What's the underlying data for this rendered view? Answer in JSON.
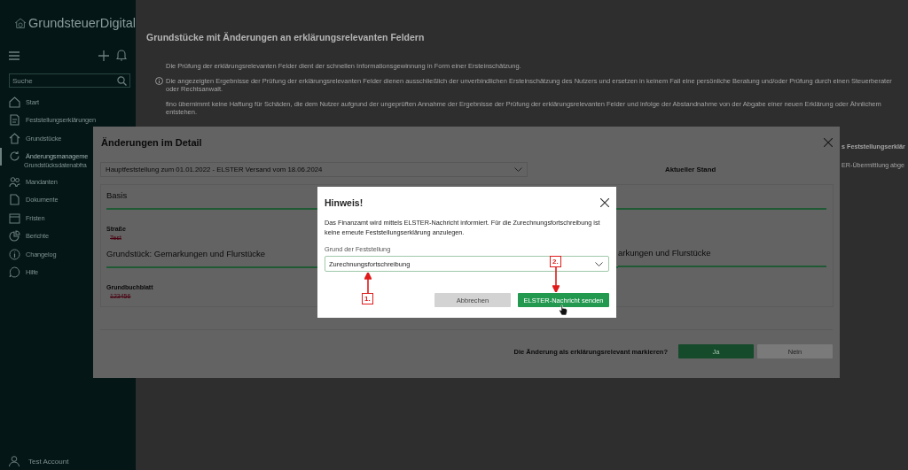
{
  "sidebar": {
    "logo": "GrundsteuerDigital",
    "search": {
      "placeholder": "Suche"
    },
    "items": [
      {
        "label": "Start",
        "selected": false
      },
      {
        "label": "Feststellungserklärungen",
        "selected": false
      },
      {
        "label": "Grundstücke",
        "selected": false
      },
      {
        "label": "Änderungsmanageme",
        "selected": true,
        "children": [
          {
            "label": "Grundstücksdatenabfra"
          }
        ]
      },
      {
        "label": "Mandanten",
        "selected": false
      },
      {
        "label": "Dokumente",
        "selected": false
      },
      {
        "label": "Fristen",
        "selected": false
      },
      {
        "label": "Berichte",
        "selected": false
      },
      {
        "label": "Changelog",
        "selected": false
      },
      {
        "label": "Hilfe",
        "selected": false
      }
    ],
    "account": "Test Account"
  },
  "page": {
    "title": "Grundstücke mit Änderungen an erklärungsrelevanten Feldern",
    "notes": [
      {
        "text": "Die Prüfung der erklärungsrelevanten Felder dient der schnellen Informationsgewinnung in Form einer Ersteinschätzung.",
        "info": false
      },
      {
        "text": "Die angezeigten Ergebnisse der Prüfung der erklärungsrelevanten Felder dienen ausschließlich der unverbindlichen Ersteinschätzung des Nutzers und ersetzen in keinem Fall eine persönliche Beratung und/oder Prüfung durch einen Steuerberater oder Rechtsanwalt.",
        "info": true
      },
      {
        "text": "fino übernimmt keine Haftung für Schäden, die dem Nutzer aufgrund der ungeprüften Annahme der Ergebnisse der Prüfung der erklärungsrelevanten Felder und infolge der Abstandnahme von der Abgabe einer neuen Erklärung oder Ähnlichem entstehen.",
        "info": false
      }
    ],
    "table": {
      "column_header": "s Feststellungserklär",
      "cell": "ER-Übermittlung abge"
    }
  },
  "detail_dialog": {
    "title": "Änderungen im Detail",
    "version_select": "Hauptfeststellung zum 01.01.2022 - ELSTER Versand vom 18.06.2024",
    "current_heading": "Aktueller Stand",
    "previous_sections": [
      {
        "title": "Basis",
        "fields": [
          {
            "label": "Straße",
            "old_value": "Test"
          }
        ]
      },
      {
        "title": "Grundstück: Gemarkungen und Flurstücke",
        "fields": [
          {
            "label": "Grundbuchblatt",
            "old_value": "123456"
          }
        ]
      }
    ],
    "current_section_title": "arkungen und Flurstücke",
    "question": "Die Änderung als erklärungsrelevant markieren?",
    "buttons": [
      {
        "label": "Ja",
        "kind": "primary"
      },
      {
        "label": "Nein",
        "kind": "secondary"
      }
    ]
  },
  "hint_dialog": {
    "title": "Hinweis!",
    "message": "Das Finanzamt wird mittels ELSTER-Nachricht informiert. Für die Zurechnungsfortschreibung ist keine erneute Feststellungserklärung anzulegen.",
    "field": {
      "label": "Grund der Feststellung",
      "value": "Zurechnungsfortschreibung"
    },
    "buttons": [
      {
        "label": "Abbrechen",
        "kind": "secondary"
      },
      {
        "label": "ELSTER-Nachricht senden",
        "kind": "primary"
      }
    ]
  },
  "annotations": [
    {
      "label": "1."
    },
    {
      "label": "2."
    }
  ]
}
